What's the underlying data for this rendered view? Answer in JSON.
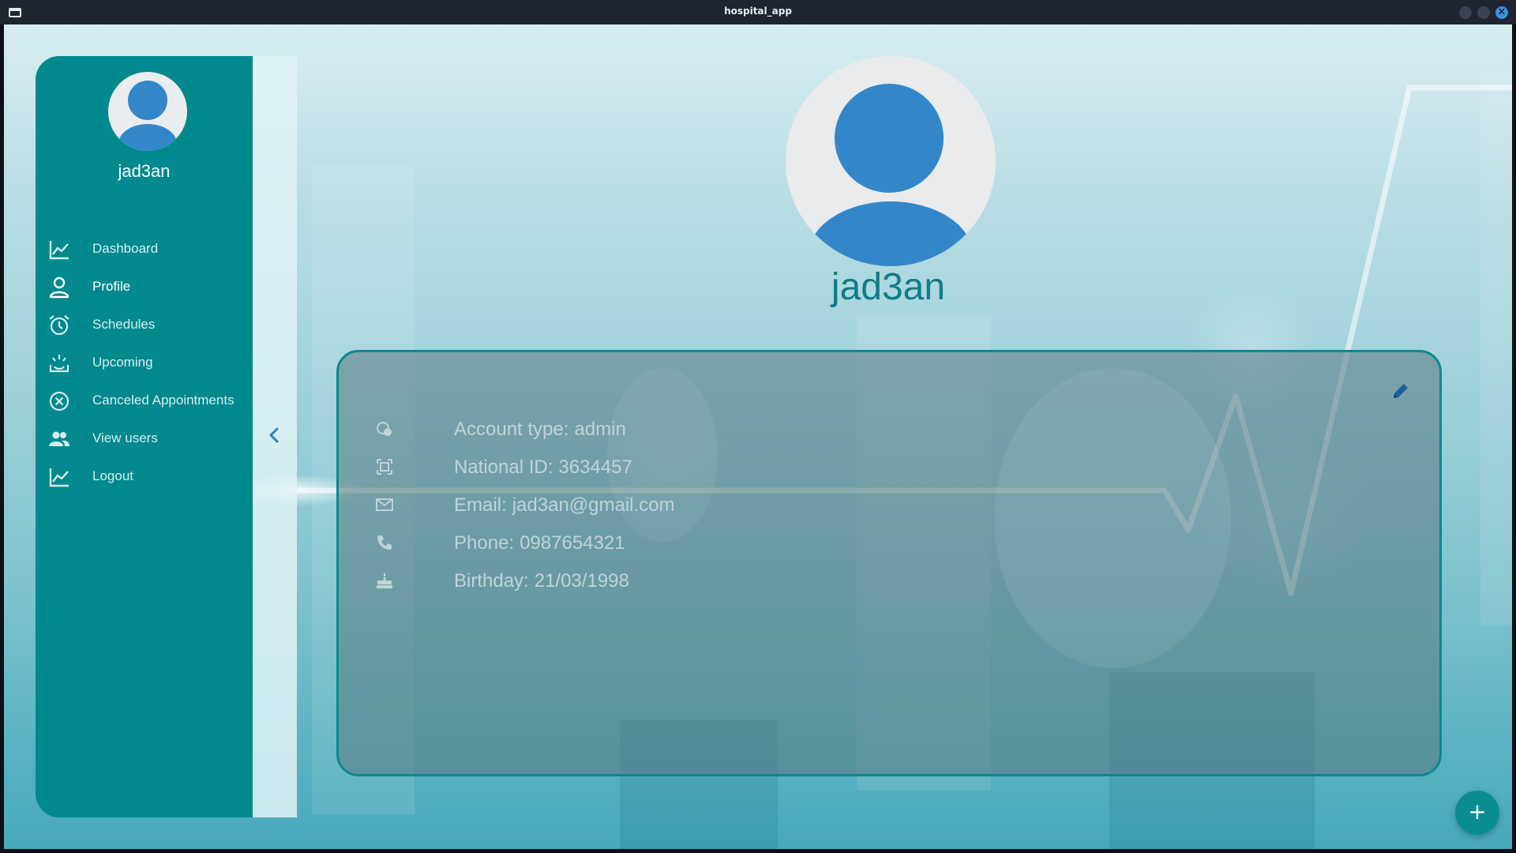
{
  "window": {
    "title": "hospital_app",
    "icon": "window-icon",
    "controls": [
      "minimize",
      "maximize",
      "close"
    ],
    "close_glyph": "✕"
  },
  "sidebar": {
    "username": "jad3an",
    "avatar_icon": "user-avatar-icon",
    "items": [
      {
        "label": "Dashboard",
        "icon": "chart-line-icon",
        "active": false
      },
      {
        "label": "Profile",
        "icon": "person-icon",
        "active": true
      },
      {
        "label": "Schedules",
        "icon": "alarm-clock-icon",
        "active": false
      },
      {
        "label": "Upcoming",
        "icon": "upcoming-icon",
        "active": false
      },
      {
        "label": "Canceled Appointments",
        "icon": "cancel-circle-icon",
        "active": false
      },
      {
        "label": "View users",
        "icon": "group-icon",
        "active": false
      },
      {
        "label": "Logout",
        "icon": "chart-line-icon",
        "active": false
      }
    ],
    "collapse_icon": "chevron-left-icon"
  },
  "profile": {
    "name": "jad3an",
    "details": [
      {
        "label": "Account type:",
        "value": "admin",
        "icon": "account-type-icon"
      },
      {
        "label": "National ID:",
        "value": "3634457",
        "icon": "id-card-icon"
      },
      {
        "label": "Email:",
        "value": "jad3an@gmail.com",
        "icon": "mail-icon"
      },
      {
        "label": "Phone:",
        "value": "0987654321",
        "icon": "phone-icon"
      },
      {
        "label": "Birthday:",
        "value": "21/03/1998",
        "icon": "cake-icon"
      }
    ],
    "edit_icon": "pencil-icon"
  },
  "fab": {
    "glyph": "+",
    "icon": "add-icon"
  },
  "colors": {
    "sidebar": "#02898e",
    "accent": "#098a90",
    "avatar_blue": "#3387c9",
    "title_bar": "#1e2430",
    "name_text": "#0f7d86"
  }
}
